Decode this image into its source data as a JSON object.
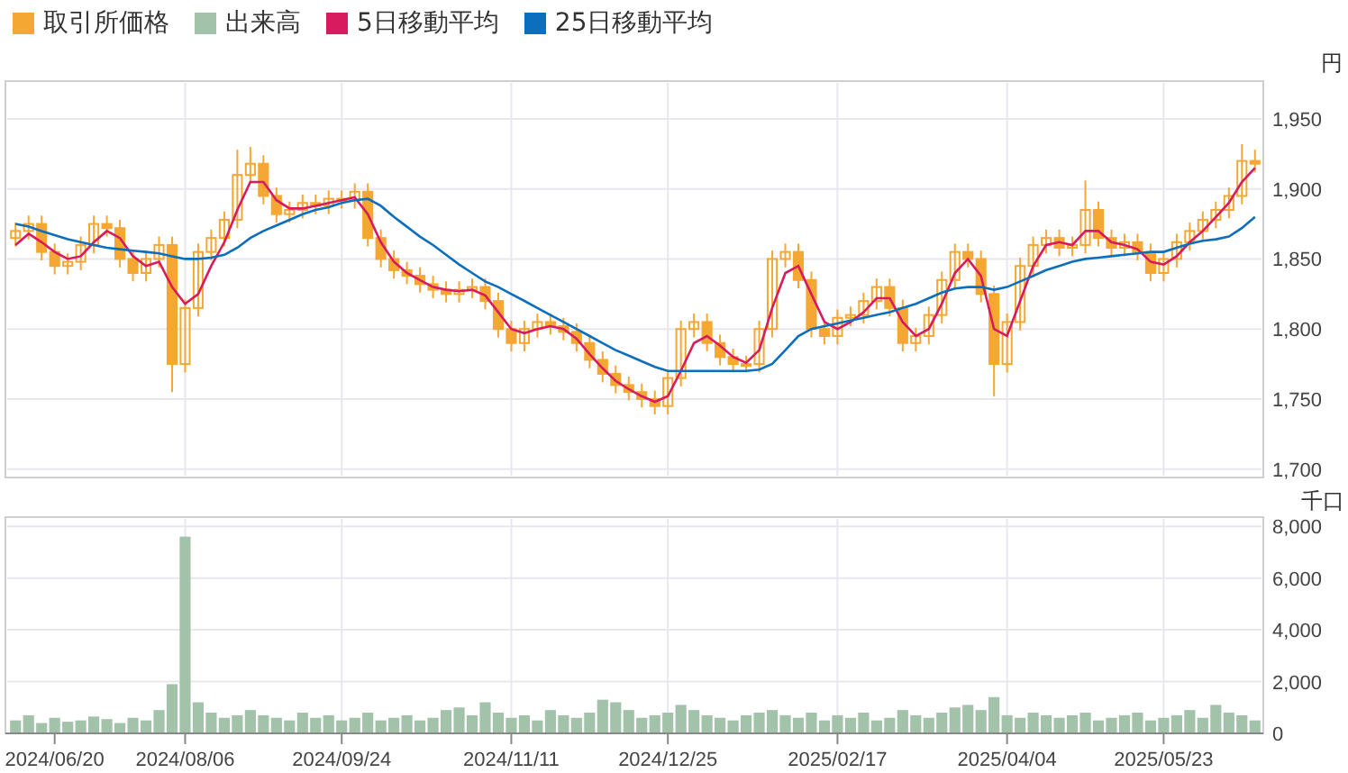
{
  "price_chart": {
    "chart_data": {
      "type": "candlestick",
      "ylabel": "円",
      "grid": true,
      "ylim": [
        1694,
        1977
      ],
      "categories": [
        null,
        null,
        null,
        null,
        null,
        null,
        null,
        null,
        null,
        null,
        null,
        null,
        null,
        null,
        null,
        null,
        null,
        null,
        null,
        null,
        null,
        null,
        null,
        null,
        null,
        null,
        null,
        null,
        null,
        null,
        null,
        null,
        null,
        null,
        null,
        null,
        null,
        null,
        null,
        null,
        null,
        null,
        null,
        null,
        null,
        null,
        null,
        null,
        null,
        null,
        null,
        null,
        null,
        null,
        null,
        null,
        null,
        null,
        null,
        null,
        null,
        null,
        null,
        null,
        null,
        null,
        null,
        null,
        null,
        null,
        null,
        null,
        null,
        null,
        null,
        null,
        null,
        null,
        null,
        null,
        null,
        null,
        null,
        null,
        null,
        null,
        null,
        null,
        null,
        null,
        null,
        null,
        null,
        null,
        null,
        null
      ],
      "yticks": [
        {
          "value": 1700,
          "label": "1,700"
        },
        {
          "value": 1750,
          "label": "1,750"
        },
        {
          "value": 1800,
          "label": "1,800"
        },
        {
          "value": 1850,
          "label": "1,850"
        },
        {
          "value": 1900,
          "label": "1,900"
        },
        {
          "value": 1950,
          "label": "1,950"
        }
      ],
      "series": [
        {
          "name": "取引所価格",
          "color": "#f5a733",
          "ohlc": [
            [
              1865,
              1876,
              1859,
              1870
            ],
            [
              1870,
              1881,
              1864,
              1875
            ],
            [
              1875,
              1881,
              1849,
              1855
            ],
            [
              1855,
              1861,
              1839,
              1845
            ],
            [
              1845,
              1854,
              1839,
              1848
            ],
            [
              1848,
              1866,
              1842,
              1860
            ],
            [
              1860,
              1881,
              1854,
              1875
            ],
            [
              1875,
              1881,
              1866,
              1872
            ],
            [
              1872,
              1878,
              1844,
              1850
            ],
            [
              1850,
              1856,
              1834,
              1840
            ],
            [
              1840,
              1856,
              1834,
              1850
            ],
            [
              1850,
              1866,
              1844,
              1860
            ],
            [
              1860,
              1866,
              1755,
              1775
            ],
            [
              1775,
              1821,
              1769,
              1815
            ],
            [
              1815,
              1861,
              1809,
              1855
            ],
            [
              1855,
              1871,
              1849,
              1865
            ],
            [
              1865,
              1884,
              1859,
              1878
            ],
            [
              1878,
              1928,
              1872,
              1910
            ],
            [
              1910,
              1930,
              1904,
              1918
            ],
            [
              1918,
              1924,
              1889,
              1895
            ],
            [
              1895,
              1901,
              1876,
              1882
            ],
            [
              1882,
              1891,
              1876,
              1885
            ],
            [
              1885,
              1896,
              1879,
              1890
            ],
            [
              1890,
              1896,
              1882,
              1888
            ],
            [
              1888,
              1899,
              1882,
              1893
            ],
            [
              1893,
              1899,
              1886,
              1892
            ],
            [
              1892,
              1904,
              1886,
              1898
            ],
            [
              1898,
              1904,
              1859,
              1865
            ],
            [
              1865,
              1871,
              1844,
              1850
            ],
            [
              1850,
              1856,
              1836,
              1842
            ],
            [
              1842,
              1848,
              1832,
              1838
            ],
            [
              1838,
              1844,
              1826,
              1832
            ],
            [
              1832,
              1838,
              1822,
              1828
            ],
            [
              1828,
              1834,
              1819,
              1825
            ],
            [
              1825,
              1834,
              1819,
              1828
            ],
            [
              1828,
              1836,
              1822,
              1830
            ],
            [
              1830,
              1836,
              1814,
              1820
            ],
            [
              1820,
              1826,
              1794,
              1800
            ],
            [
              1800,
              1806,
              1784,
              1790
            ],
            [
              1790,
              1806,
              1784,
              1800
            ],
            [
              1800,
              1811,
              1794,
              1805
            ],
            [
              1805,
              1811,
              1796,
              1802
            ],
            [
              1802,
              1808,
              1792,
              1798
            ],
            [
              1798,
              1804,
              1784,
              1790
            ],
            [
              1790,
              1796,
              1772,
              1778
            ],
            [
              1778,
              1784,
              1762,
              1768
            ],
            [
              1768,
              1774,
              1754,
              1760
            ],
            [
              1760,
              1766,
              1749,
              1755
            ],
            [
              1755,
              1761,
              1744,
              1750
            ],
            [
              1750,
              1756,
              1739,
              1745
            ],
            [
              1745,
              1771,
              1739,
              1765
            ],
            [
              1765,
              1806,
              1759,
              1800
            ],
            [
              1800,
              1811,
              1794,
              1805
            ],
            [
              1805,
              1811,
              1784,
              1790
            ],
            [
              1790,
              1796,
              1774,
              1780
            ],
            [
              1780,
              1786,
              1769,
              1775
            ],
            [
              1775,
              1781,
              1769,
              1775
            ],
            [
              1775,
              1806,
              1769,
              1800
            ],
            [
              1800,
              1856,
              1794,
              1850
            ],
            [
              1850,
              1861,
              1844,
              1855
            ],
            [
              1855,
              1861,
              1829,
              1835
            ],
            [
              1835,
              1841,
              1794,
              1800
            ],
            [
              1800,
              1806,
              1789,
              1795
            ],
            [
              1795,
              1814,
              1789,
              1808
            ],
            [
              1808,
              1816,
              1802,
              1810
            ],
            [
              1810,
              1826,
              1804,
              1820
            ],
            [
              1820,
              1836,
              1814,
              1830
            ],
            [
              1830,
              1836,
              1809,
              1815
            ],
            [
              1815,
              1821,
              1784,
              1790
            ],
            [
              1790,
              1801,
              1784,
              1795
            ],
            [
              1795,
              1816,
              1789,
              1810
            ],
            [
              1810,
              1841,
              1804,
              1835
            ],
            [
              1835,
              1861,
              1829,
              1855
            ],
            [
              1855,
              1861,
              1844,
              1850
            ],
            [
              1850,
              1856,
              1819,
              1825
            ],
            [
              1825,
              1831,
              1752,
              1775
            ],
            [
              1775,
              1811,
              1769,
              1805
            ],
            [
              1805,
              1851,
              1799,
              1845
            ],
            [
              1845,
              1866,
              1839,
              1860
            ],
            [
              1860,
              1871,
              1854,
              1865
            ],
            [
              1865,
              1871,
              1852,
              1858
            ],
            [
              1858,
              1866,
              1852,
              1860
            ],
            [
              1860,
              1906,
              1854,
              1885
            ],
            [
              1885,
              1891,
              1859,
              1865
            ],
            [
              1865,
              1871,
              1852,
              1858
            ],
            [
              1858,
              1868,
              1852,
              1862
            ],
            [
              1862,
              1868,
              1849,
              1855
            ],
            [
              1855,
              1861,
              1834,
              1840
            ],
            [
              1840,
              1856,
              1834,
              1850
            ],
            [
              1850,
              1868,
              1844,
              1862
            ],
            [
              1862,
              1876,
              1856,
              1870
            ],
            [
              1870,
              1884,
              1864,
              1878
            ],
            [
              1878,
              1891,
              1872,
              1885
            ],
            [
              1885,
              1901,
              1879,
              1895
            ],
            [
              1895,
              1932,
              1889,
              1920
            ],
            [
              1920,
              1928,
              1912,
              1918
            ]
          ]
        },
        {
          "name": "5日移動平均",
          "color": "#d81b5e",
          "type": "line",
          "values": [
            1860,
            1868,
            1862,
            1855,
            1850,
            1852,
            1862,
            1870,
            1865,
            1852,
            1845,
            1848,
            1830,
            1818,
            1825,
            1845,
            1862,
            1885,
            1905,
            1905,
            1892,
            1886,
            1886,
            1888,
            1890,
            1892,
            1894,
            1882,
            1862,
            1848,
            1840,
            1835,
            1830,
            1828,
            1827,
            1828,
            1824,
            1812,
            1800,
            1797,
            1800,
            1802,
            1800,
            1793,
            1782,
            1772,
            1763,
            1757,
            1752,
            1748,
            1752,
            1770,
            1790,
            1795,
            1788,
            1780,
            1776,
            1785,
            1815,
            1840,
            1845,
            1825,
            1805,
            1800,
            1805,
            1812,
            1822,
            1822,
            1805,
            1795,
            1800,
            1818,
            1840,
            1850,
            1838,
            1800,
            1795,
            1820,
            1845,
            1860,
            1862,
            1860,
            1870,
            1870,
            1862,
            1860,
            1857,
            1848,
            1846,
            1852,
            1862,
            1870,
            1880,
            1890,
            1905,
            1915
          ]
        },
        {
          "name": "25日移動平均",
          "color": "#0c6fbe",
          "type": "line",
          "values": [
            1875,
            1873,
            1870,
            1867,
            1864,
            1862,
            1860,
            1858,
            1857,
            1856,
            1855,
            1854,
            1852,
            1850,
            1850,
            1851,
            1853,
            1858,
            1865,
            1870,
            1874,
            1878,
            1882,
            1885,
            1887,
            1890,
            1892,
            1893,
            1888,
            1880,
            1873,
            1866,
            1860,
            1853,
            1846,
            1840,
            1834,
            1830,
            1825,
            1820,
            1815,
            1810,
            1805,
            1800,
            1795,
            1790,
            1785,
            1781,
            1777,
            1773,
            1770,
            1770,
            1770,
            1770,
            1770,
            1770,
            1770,
            1771,
            1775,
            1785,
            1795,
            1800,
            1802,
            1804,
            1806,
            1808,
            1810,
            1812,
            1815,
            1818,
            1822,
            1826,
            1829,
            1830,
            1830,
            1828,
            1830,
            1834,
            1838,
            1842,
            1845,
            1848,
            1850,
            1851,
            1852,
            1853,
            1854,
            1855,
            1855,
            1858,
            1861,
            1863,
            1864,
            1866,
            1872,
            1880
          ]
        }
      ]
    }
  },
  "volume_chart": {
    "chart_data": {
      "type": "bar",
      "ylabel": "千口",
      "grid": true,
      "ylim": [
        0,
        8354
      ],
      "categories": [
        null,
        null,
        null,
        "2024/06/20",
        null,
        null,
        null,
        null,
        null,
        null,
        null,
        null,
        null,
        "2024/08/06",
        null,
        null,
        null,
        null,
        null,
        null,
        null,
        null,
        null,
        null,
        null,
        "2024/09/24",
        null,
        null,
        null,
        null,
        null,
        null,
        null,
        null,
        null,
        null,
        null,
        null,
        "2024/11/11",
        null,
        null,
        null,
        null,
        null,
        null,
        null,
        null,
        null,
        null,
        null,
        "2024/12/25",
        null,
        null,
        null,
        null,
        null,
        null,
        null,
        null,
        null,
        null,
        null,
        null,
        "2025/02/17",
        null,
        null,
        null,
        null,
        null,
        null,
        null,
        null,
        null,
        null,
        null,
        null,
        "2025/04/04",
        null,
        null,
        null,
        null,
        null,
        null,
        null,
        null,
        null,
        null,
        null,
        "2025/05/23",
        null,
        null,
        null,
        null,
        null,
        null,
        null
      ],
      "yticks": [
        {
          "value": 0,
          "label": "0"
        },
        {
          "value": 2000,
          "label": "2,000"
        },
        {
          "value": 4000,
          "label": "4,000"
        },
        {
          "value": 6000,
          "label": "6,000"
        },
        {
          "value": 8000,
          "label": "8,000"
        }
      ],
      "series": [
        {
          "name": "出来高",
          "color": "#a2c2aa",
          "values": [
            500,
            700,
            400,
            600,
            450,
            500,
            650,
            550,
            400,
            600,
            500,
            900,
            1900,
            7600,
            1200,
            800,
            600,
            700,
            900,
            700,
            600,
            500,
            800,
            600,
            700,
            500,
            600,
            800,
            500,
            600,
            700,
            500,
            600,
            900,
            1000,
            700,
            1200,
            800,
            600,
            700,
            500,
            900,
            700,
            600,
            800,
            1300,
            1200,
            900,
            600,
            700,
            800,
            1100,
            900,
            700,
            600,
            500,
            700,
            800,
            900,
            700,
            600,
            800,
            500,
            700,
            600,
            800,
            500,
            600,
            900,
            700,
            600,
            800,
            1000,
            1100,
            900,
            1400,
            700,
            600,
            800,
            700,
            600,
            700,
            800,
            500,
            600,
            700,
            800,
            500,
            600,
            700,
            900,
            600,
            1100,
            800,
            700,
            500
          ]
        }
      ]
    }
  }
}
